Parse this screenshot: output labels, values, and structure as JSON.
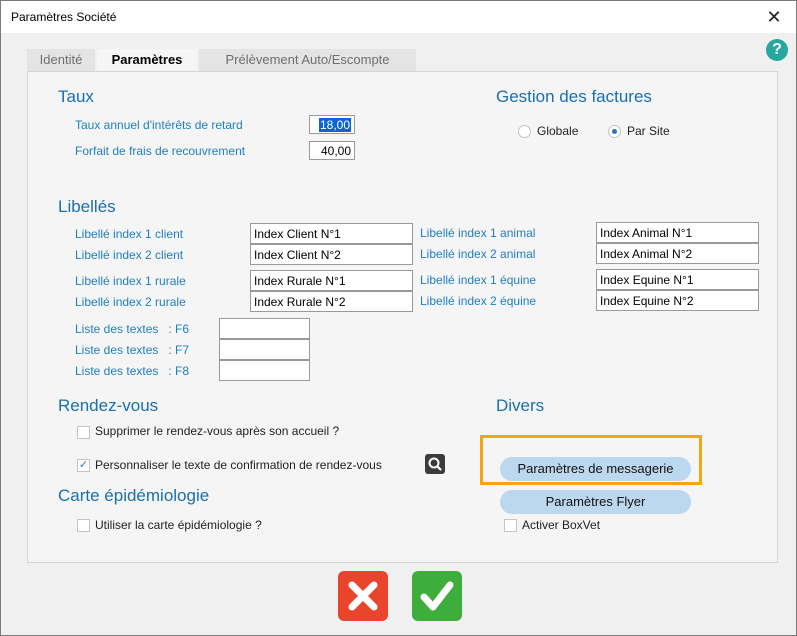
{
  "window": {
    "title": "Paramètres Société",
    "close_glyph": "✕",
    "help_glyph": "?"
  },
  "tabs": [
    {
      "label": "Identité",
      "active": false
    },
    {
      "label": "Paramètres",
      "active": true
    },
    {
      "label": "Prélèvement Auto/Escompte",
      "active": false
    }
  ],
  "taux": {
    "heading": "Taux",
    "interest_label": "Taux annuel d'intérêts de retard",
    "interest_value": "18,00",
    "forfait_label": "Forfait de frais de recouvrement",
    "forfait_value": "40,00"
  },
  "factures": {
    "heading": "Gestion des factures",
    "options": [
      {
        "label": "Globale",
        "selected": false
      },
      {
        "label": "Par Site",
        "selected": true
      }
    ]
  },
  "libelles": {
    "heading": "Libellés",
    "left": [
      {
        "label": "Libellé index 1 client",
        "value": "Index Client N°1"
      },
      {
        "label": "Libellé index 2 client",
        "value": "Index Client N°2"
      },
      {
        "label": "Libellé index 1 rurale",
        "value": "Index Rurale N°1"
      },
      {
        "label": "Libellé index 2 rurale",
        "value": "Index Rurale N°2"
      }
    ],
    "right": [
      {
        "label": "Libellé index 1 animal",
        "value": "Index Animal N°1"
      },
      {
        "label": "Libellé index 2 animal",
        "value": "Index Animal N°2"
      },
      {
        "label": "Libellé index 1 équine",
        "value": "Index Equine N°1"
      },
      {
        "label": "Libellé index 2 équine",
        "value": "Index Equine N°2"
      }
    ],
    "textes": [
      {
        "label": "Liste des textes   : F6",
        "value": ""
      },
      {
        "label": "Liste des textes   : F7",
        "value": ""
      },
      {
        "label": "Liste des textes   : F8",
        "value": ""
      }
    ]
  },
  "rdv": {
    "heading": "Rendez-vous",
    "supprimer_label": "Supprimer le rendez-vous après son accueil ?",
    "supprimer_checked": false,
    "personnaliser_label": "Personnaliser le texte de confirmation de rendez-vous",
    "personnaliser_checked": true
  },
  "carte": {
    "heading": "Carte épidémiologie",
    "utiliser_label": "Utiliser la carte épidémiologie ?",
    "utiliser_checked": false
  },
  "divers": {
    "heading": "Divers",
    "messagerie_label": "Paramètres de messagerie",
    "flyer_label": "Paramètres Flyer",
    "boxvet_label": "Activer BoxVet",
    "boxvet_checked": false
  },
  "colors": {
    "accent": "#1a6fb0",
    "highlight": "#f5a510",
    "cancel": "#e8452c",
    "ok": "#3dae3c"
  },
  "icons": {
    "close": "close-icon",
    "help": "help-icon",
    "search": "search-icon",
    "cancel": "x-icon",
    "ok": "checkmark-icon"
  }
}
